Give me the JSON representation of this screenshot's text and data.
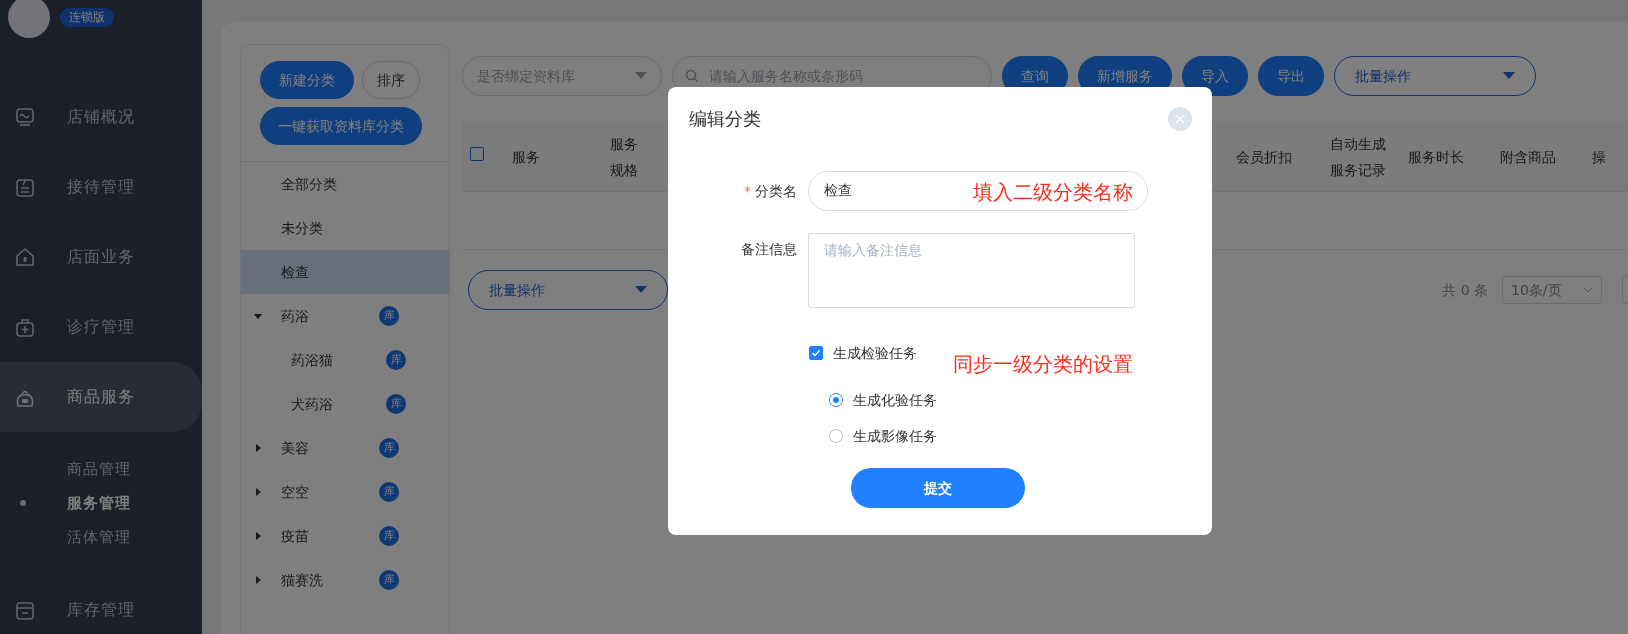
{
  "sidebar": {
    "badge": "连锁版",
    "items": [
      {
        "label": "店铺概况",
        "selected": false
      },
      {
        "label": "接待管理",
        "selected": false
      },
      {
        "label": "店面业务",
        "selected": false
      },
      {
        "label": "诊疗管理",
        "selected": false
      },
      {
        "label": "商品服务",
        "selected": true,
        "children": [
          {
            "label": "商品管理",
            "selected": false
          },
          {
            "label": "服务管理",
            "selected": true
          },
          {
            "label": "活体管理",
            "selected": false
          }
        ]
      },
      {
        "label": "库存管理",
        "selected": false
      }
    ]
  },
  "categories": {
    "buttons": [
      "新建分类",
      "排序",
      "一键获取资料库分类"
    ],
    "items": [
      {
        "label": "全部分类",
        "selected": false
      },
      {
        "label": "未分类",
        "selected": false
      },
      {
        "label": "检查",
        "selected": true
      },
      {
        "label": "药浴",
        "selected": false,
        "expanded": true,
        "badge": "库",
        "children": [
          {
            "label": "药浴猫",
            "selected": false,
            "badge": "库"
          },
          {
            "label": "犬药浴",
            "selected": false,
            "badge": "库"
          }
        ]
      },
      {
        "label": "美容",
        "selected": false,
        "expanded": false,
        "badge": "库"
      },
      {
        "label": "空空",
        "selected": false,
        "expanded": false,
        "badge": "库"
      },
      {
        "label": "疫苗",
        "selected": false,
        "expanded": false,
        "badge": "库"
      },
      {
        "label": "猫赛洗",
        "selected": false,
        "expanded": false,
        "badge": "库"
      }
    ]
  },
  "toolbar": {
    "bind_select": {
      "placeholder": "是否绑定资料库"
    },
    "search": {
      "placeholder": "请输入服务名称或条形码"
    },
    "buttons": [
      "查询",
      "新增服务",
      "导入",
      "导出"
    ],
    "batch": {
      "label": "批量操作"
    }
  },
  "table": {
    "select_all": {
      "checked": false
    },
    "columns": [
      "服务",
      "服务规格",
      "会员折扣",
      "自动生成服务记录",
      "服务时长",
      "附含商品",
      "操"
    ]
  },
  "footer": {
    "batch": {
      "label": "批量操作"
    },
    "total": "共 0 条",
    "page_size": "10条/页"
  },
  "modal": {
    "title": "编辑分类",
    "name_field": {
      "required_mark": "*",
      "label": "分类名",
      "value": "检查"
    },
    "note_field": {
      "label": "备注信息",
      "placeholder": "请输入备注信息"
    },
    "task_checkbox": {
      "label": "生成检验任务",
      "checked": true
    },
    "radios": [
      {
        "label": "生成化验任务",
        "selected": true
      },
      {
        "label": "生成影像任务",
        "selected": false
      }
    ],
    "submit": "提交",
    "annotations": [
      "填入二级分类名称",
      "同步一级分类的设置"
    ]
  }
}
